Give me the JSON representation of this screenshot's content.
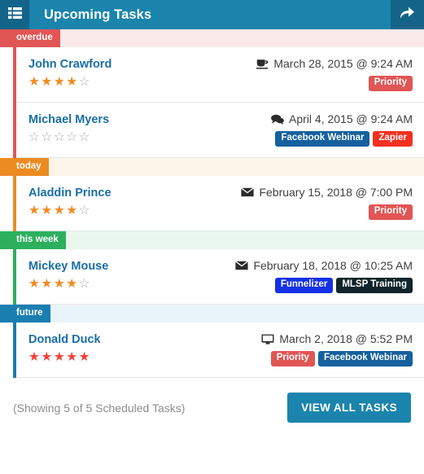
{
  "header": {
    "title": "Upcoming Tasks",
    "menu_icon": "th-list-icon",
    "share_icon": "share-arrow-icon",
    "bg_color": "#1a84ac",
    "btn_bg_color": "#14648a"
  },
  "sections": [
    {
      "label": "overdue",
      "color": "#e25555",
      "bg": "#fbeaea",
      "tasks": [
        {
          "name": "John Crawford",
          "stars_filled": 4,
          "stars_total": 5,
          "star_color": "#f18a21",
          "date": "March 28, 2015 @ 9:24 AM",
          "date_icon": "coffee-icon",
          "tags": [
            {
              "label": "Priority",
              "color": "#e25555"
            }
          ]
        },
        {
          "name": "Michael Myers",
          "stars_filled": 0,
          "stars_total": 5,
          "star_color": "#aaaaaa",
          "date": "April 4, 2015 @ 9:24 AM",
          "date_icon": "comments-icon",
          "tags": [
            {
              "label": "Facebook Webinar",
              "color": "#15609e"
            },
            {
              "label": "Zapier",
              "color": "#f4301f"
            }
          ]
        }
      ]
    },
    {
      "label": "today",
      "color": "#ec8b22",
      "bg": "#fdf5e9",
      "tasks": [
        {
          "name": "Aladdin Prince",
          "stars_filled": 4,
          "stars_total": 5,
          "star_color": "#f18a21",
          "date": "February 15, 2018 @ 7:00 PM",
          "date_icon": "envelope-icon",
          "tags": [
            {
              "label": "Priority",
              "color": "#e25555"
            }
          ]
        }
      ]
    },
    {
      "label": "this week",
      "color": "#2cb05e",
      "bg": "#eaf7ee",
      "tasks": [
        {
          "name": "Mickey Mouse",
          "stars_filled": 4,
          "stars_total": 5,
          "star_color": "#f18a21",
          "date": "February 18, 2018 @ 10:25 AM",
          "date_icon": "envelope-icon",
          "tags": [
            {
              "label": "Funnelizer",
              "color": "#1431e8"
            },
            {
              "label": "MLSP Training",
              "color": "#10242b"
            }
          ]
        }
      ]
    },
    {
      "label": "future",
      "color": "#1a7eb0",
      "bg": "#e9f3fa",
      "tasks": [
        {
          "name": "Donald Duck",
          "stars_filled": 5,
          "stars_total": 5,
          "star_color": "#f4403a",
          "date": "March 2, 2018 @ 5:52 PM",
          "date_icon": "desktop-icon",
          "tags": [
            {
              "label": "Priority",
              "color": "#e25555"
            },
            {
              "label": "Facebook Webinar",
              "color": "#15609e"
            }
          ]
        }
      ]
    }
  ],
  "footer": {
    "note": "(Showing 5 of 5 Scheduled Tasks)",
    "view_all_label": "VIEW ALL TASKS",
    "view_all_color": "#1a84ac"
  }
}
